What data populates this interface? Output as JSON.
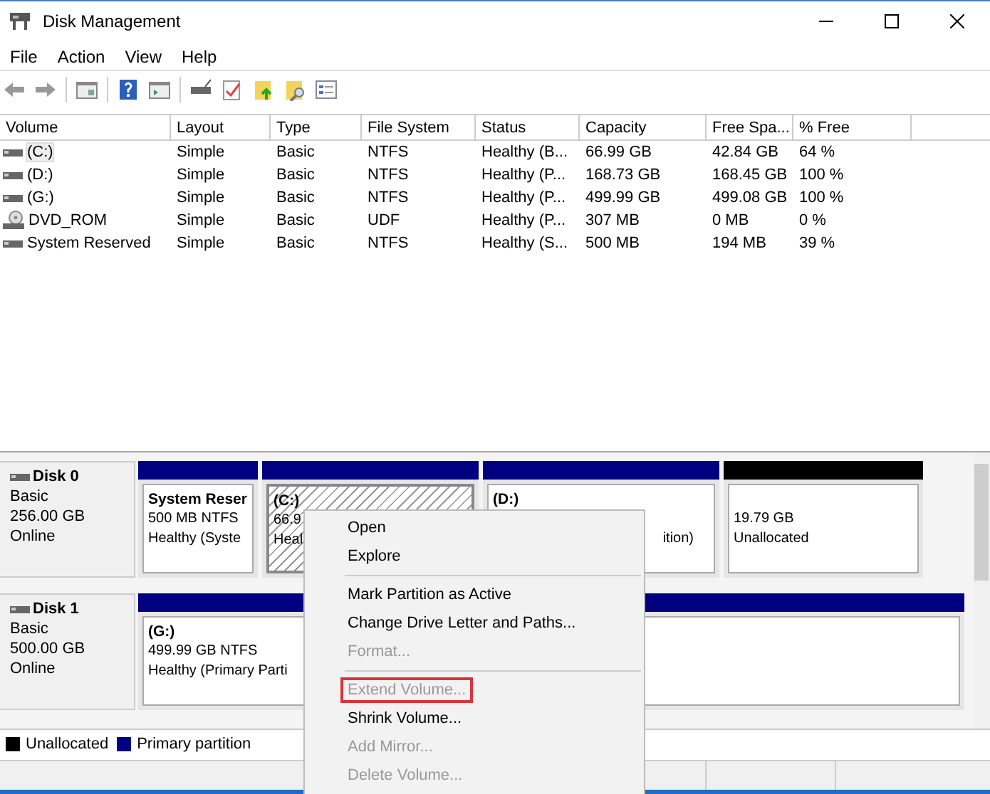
{
  "window": {
    "title": "Disk Management"
  },
  "menu": [
    "File",
    "Action",
    "View",
    "Help"
  ],
  "volumes": {
    "columns": [
      "Volume",
      "Layout",
      "Type",
      "File System",
      "Status",
      "Capacity",
      "Free Spa...",
      "% Free"
    ],
    "rows": [
      {
        "kind": "drive",
        "selected": true,
        "cells": [
          "(C:)",
          "Simple",
          "Basic",
          "NTFS",
          "Healthy (B...",
          "66.99 GB",
          "42.84 GB",
          "64 %"
        ]
      },
      {
        "kind": "drive",
        "selected": false,
        "cells": [
          "(D:)",
          "Simple",
          "Basic",
          "NTFS",
          "Healthy (P...",
          "168.73 GB",
          "168.45 GB",
          "100 %"
        ]
      },
      {
        "kind": "drive",
        "selected": false,
        "cells": [
          "(G:)",
          "Simple",
          "Basic",
          "NTFS",
          "Healthy (P...",
          "499.99 GB",
          "499.08 GB",
          "100 %"
        ]
      },
      {
        "kind": "optical",
        "selected": false,
        "cells": [
          "DVD_ROM",
          "Simple",
          "Basic",
          "UDF",
          "Healthy (P...",
          "307 MB",
          "0 MB",
          "0 %"
        ]
      },
      {
        "kind": "drive",
        "selected": false,
        "cells": [
          "System Reserved",
          "Simple",
          "Basic",
          "NTFS",
          "Healthy (S...",
          "500 MB",
          "194 MB",
          "39 %"
        ]
      }
    ]
  },
  "disks": [
    {
      "name": "Disk 0",
      "type": "Basic",
      "size": "256.00 GB",
      "status": "Online",
      "partitions": [
        {
          "kind": "primary",
          "selected": false,
          "label": "System Reser",
          "size_text": "500 MB NTFS",
          "status_text": "Healthy (Syste"
        },
        {
          "kind": "primary",
          "selected": true,
          "label": "(C:)",
          "size_text": "66.9",
          "status_text": "Heal"
        },
        {
          "kind": "primary",
          "selected": false,
          "label": "(D:)",
          "status_text": "ition)"
        },
        {
          "kind": "unallocated",
          "selected": false,
          "size_text": "19.79 GB",
          "status_text": "Unallocated"
        }
      ]
    },
    {
      "name": "Disk 1",
      "type": "Basic",
      "size": "500.00 GB",
      "status": "Online",
      "partitions": [
        {
          "kind": "primary",
          "selected": false,
          "label": "(G:)",
          "size_text": "499.99 GB NTFS",
          "status_text": "Healthy (Primary Parti"
        }
      ]
    }
  ],
  "legend": [
    {
      "label": "Unallocated",
      "color": "#000000"
    },
    {
      "label": "Primary partition",
      "color": "#000080"
    }
  ],
  "context_menu": [
    {
      "kind": "item",
      "label": "Open",
      "disabled": false,
      "highlighted": false
    },
    {
      "kind": "item",
      "label": "Explore",
      "disabled": false,
      "highlighted": false
    },
    {
      "kind": "separator"
    },
    {
      "kind": "item",
      "label": "Mark Partition as Active",
      "disabled": false,
      "highlighted": false
    },
    {
      "kind": "item",
      "label": "Change Drive Letter and Paths...",
      "disabled": false,
      "highlighted": false
    },
    {
      "kind": "item",
      "label": "Format...",
      "disabled": true,
      "highlighted": false
    },
    {
      "kind": "separator"
    },
    {
      "kind": "item",
      "label": "Extend Volume...",
      "disabled": true,
      "highlighted": true
    },
    {
      "kind": "item",
      "label": "Shrink Volume...",
      "disabled": false,
      "highlighted": false
    },
    {
      "kind": "item",
      "label": "Add Mirror...",
      "disabled": true,
      "highlighted": false
    },
    {
      "kind": "item",
      "label": "Delete Volume...",
      "disabled": true,
      "highlighted": false
    }
  ]
}
